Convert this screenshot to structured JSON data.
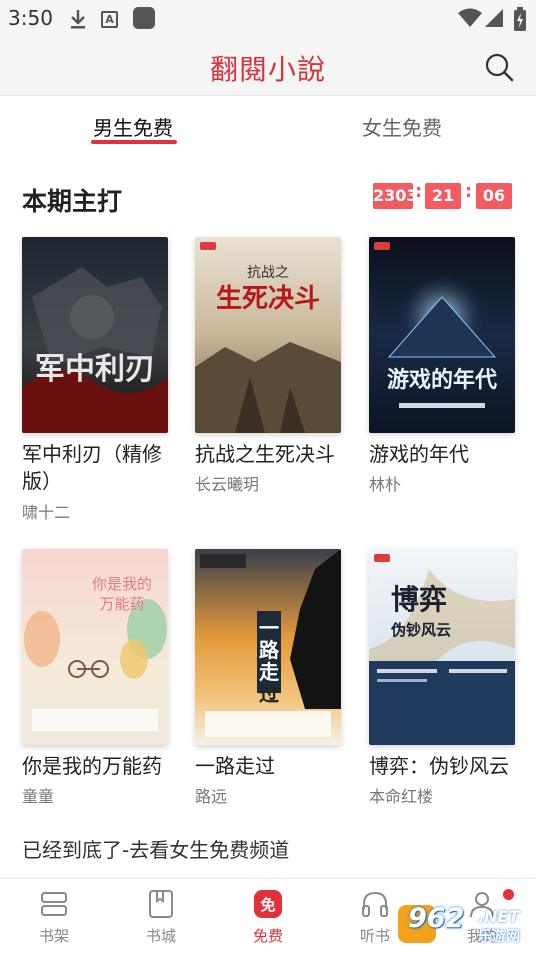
{
  "status_bar": {
    "time": "3:50",
    "icons": [
      "download-icon",
      "a-icon",
      "app-square-icon",
      "wifi-icon",
      "cellular-icon",
      "battery-icon"
    ]
  },
  "header": {
    "title": "翻閱小說",
    "search_icon": "search-icon",
    "accent_color": "#e0303c"
  },
  "tabs": [
    {
      "label": "男生免费",
      "active": true
    },
    {
      "label": "女生免费",
      "active": false
    }
  ],
  "section": {
    "title": "本期主打",
    "countdown": {
      "hours": "2303",
      "minutes": "21",
      "seconds": "06"
    }
  },
  "books": [
    {
      "title": "军中利刃（精修版）",
      "author": "啸十二",
      "cover_text": "军中利刃"
    },
    {
      "title": "抗战之生死决斗",
      "author": "长云曦玥",
      "cover_text": "抗战之生死决斗"
    },
    {
      "title": "游戏的年代",
      "author": "林朴",
      "cover_text": "游戏的年代"
    },
    {
      "title": "你是我的万能药",
      "author": "童童",
      "cover_text": "你是我的万能药"
    },
    {
      "title": "一路走过",
      "author": "路远",
      "cover_text": "一路走过"
    },
    {
      "title": "博弈：伪钞风云",
      "author": "本命红楼",
      "cover_text": "博弈 伪钞风云"
    }
  ],
  "footer_link": "已经到底了-去看女生免费频道",
  "bottom_nav": [
    {
      "label": "书架",
      "icon": "bookshelf-icon",
      "active": false
    },
    {
      "label": "书城",
      "icon": "bookstore-icon",
      "active": false
    },
    {
      "label": "免费",
      "icon": "free-icon",
      "active": true,
      "icon_text": "免"
    },
    {
      "label": "听书",
      "icon": "headphones-icon",
      "active": false
    },
    {
      "label": "我的",
      "icon": "profile-icon",
      "active": false
    }
  ],
  "watermark": {
    "number": "962",
    "suffix": ".NET",
    "site": "乐游网"
  }
}
